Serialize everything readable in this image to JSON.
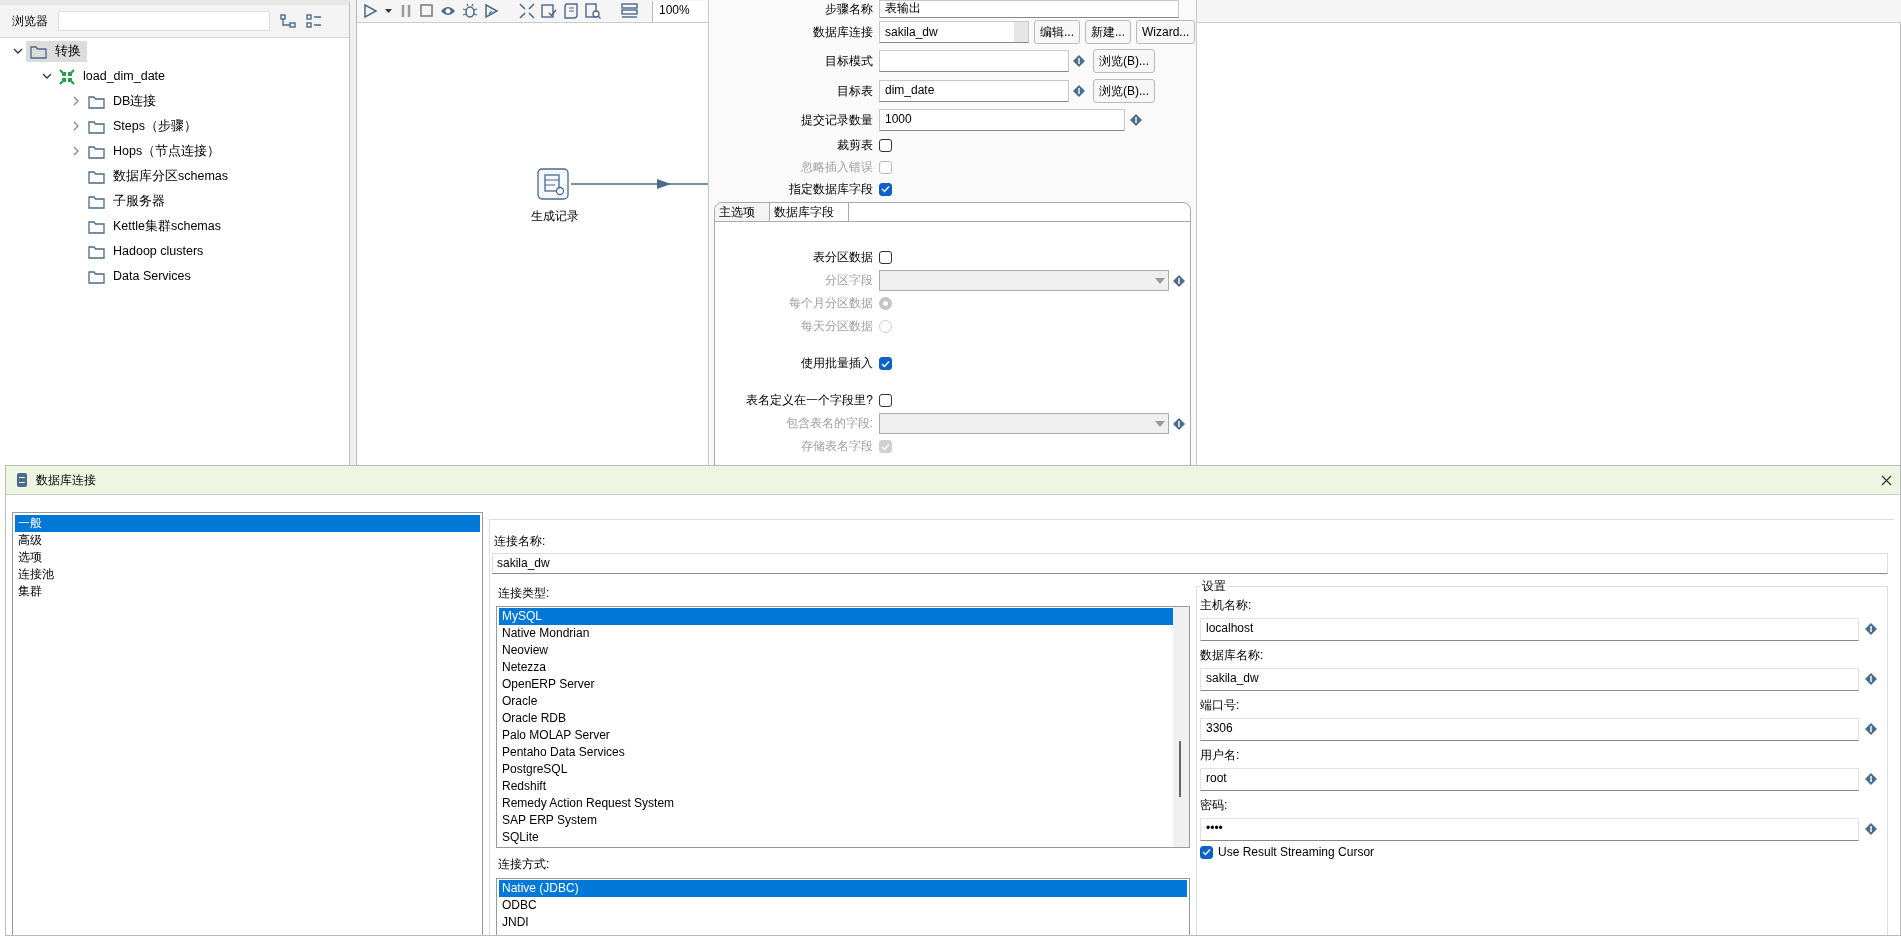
{
  "browser": {
    "label": "浏览器"
  },
  "tree": [
    {
      "label": "转换",
      "kind": "folder",
      "expanded": true,
      "selected": true,
      "children": [
        {
          "label": "load_dim_date",
          "kind": "transformation",
          "expanded": true,
          "selected": false,
          "children": [
            {
              "label": "DB连接",
              "kind": "folder",
              "expanded": false,
              "selected": false
            },
            {
              "label": "Steps（步骤）",
              "kind": "folder",
              "expanded": false,
              "selected": false
            },
            {
              "label": "Hops（节点连接）",
              "kind": "folder",
              "expanded": false,
              "selected": false
            },
            {
              "label": "数据库分区schemas",
              "kind": "folder",
              "selected": false
            },
            {
              "label": "子服务器",
              "kind": "folder",
              "selected": false
            },
            {
              "label": "Kettle集群schemas",
              "kind": "folder",
              "selected": false
            },
            {
              "label": "Hadoop clusters",
              "kind": "folder",
              "selected": false
            },
            {
              "label": "Data Services",
              "kind": "folder",
              "selected": false
            }
          ]
        }
      ]
    }
  ],
  "toolbar": {
    "zoom": "100%"
  },
  "canvas": {
    "steps": [
      {
        "label": "生成记录"
      }
    ]
  },
  "step_dialog": {
    "rows": [
      {
        "kind": "text",
        "label": "步骤名称",
        "value": "表输出"
      },
      {
        "kind": "connection",
        "label": "数据库连接",
        "value": "sakila_dw",
        "buttons": [
          "编辑...",
          "新建...",
          "Wizard..."
        ]
      },
      {
        "kind": "browse",
        "label": "目标模式",
        "button": "浏览(B)..."
      },
      {
        "kind": "browse",
        "label": "目标表",
        "value": "dim_date",
        "button": "浏览(B)..."
      },
      {
        "kind": "variable",
        "label": "提交记录数量",
        "value": "1000"
      },
      {
        "kind": "checkbox",
        "label": "裁剪表",
        "checked": false,
        "disabled": false
      },
      {
        "kind": "checkbox",
        "label": "忽略插入错误",
        "checked": false,
        "disabled": true
      },
      {
        "kind": "checkbox",
        "label": "指定数据库字段",
        "checked": true,
        "disabled": false
      }
    ],
    "tabs": [
      {
        "label": "主选项",
        "selected": true
      },
      {
        "label": "数据库字段",
        "selected": false
      }
    ],
    "tab_groups": [
      [
        {
          "kind": "checkbox",
          "label": "表分区数据",
          "checked": false,
          "disabled": false
        },
        {
          "kind": "combo",
          "label": "分区字段",
          "disabled": true
        },
        {
          "kind": "radio",
          "label": "每个月分区数据",
          "checked": true,
          "disabled": true
        },
        {
          "kind": "radio",
          "label": "每天分区数据",
          "checked": false,
          "disabled": true
        }
      ],
      [
        {
          "kind": "checkbox",
          "label": "使用批量插入",
          "checked": true,
          "disabled": false
        }
      ],
      [
        {
          "kind": "checkbox",
          "label": "表名定义在一个字段里?",
          "checked": false,
          "disabled": false
        },
        {
          "kind": "combo",
          "label": "包含表名的字段:",
          "disabled": true
        },
        {
          "kind": "checkbox",
          "label": "存储表名字段",
          "checked": true,
          "disabled": true
        }
      ]
    ]
  },
  "db_dialog": {
    "title": "数据库连接",
    "sections": [
      {
        "label": "一般",
        "selected": true
      },
      {
        "label": "高级",
        "selected": false
      },
      {
        "label": "选项",
        "selected": false
      },
      {
        "label": "连接池",
        "selected": false
      },
      {
        "label": "集群",
        "selected": false
      }
    ],
    "name_label": "连接名称:",
    "name_value": "sakila_dw",
    "type_label": "连接类型:",
    "types": [
      {
        "label": "MySQL",
        "selected": true
      },
      {
        "label": "Native Mondrian",
        "selected": false
      },
      {
        "label": "Neoview",
        "selected": false
      },
      {
        "label": "Netezza",
        "selected": false
      },
      {
        "label": "OpenERP Server",
        "selected": false
      },
      {
        "label": "Oracle",
        "selected": false
      },
      {
        "label": "Oracle RDB",
        "selected": false
      },
      {
        "label": "Palo MOLAP Server",
        "selected": false
      },
      {
        "label": "Pentaho Data Services",
        "selected": false
      },
      {
        "label": "PostgreSQL",
        "selected": false
      },
      {
        "label": "Redshift",
        "selected": false
      },
      {
        "label": "Remedy Action Request System",
        "selected": false
      },
      {
        "label": "SAP ERP System",
        "selected": false
      },
      {
        "label": "SQLite",
        "selected": false
      }
    ],
    "access_label": "连接方式:",
    "access": [
      {
        "label": "Native (JDBC)",
        "selected": true
      },
      {
        "label": "ODBC",
        "selected": false
      },
      {
        "label": "JNDI",
        "selected": false
      }
    ],
    "settings": {
      "legend": "设置",
      "fields": [
        {
          "label": "主机名称:",
          "value": "localhost"
        },
        {
          "label": "数据库名称:",
          "value": "sakila_dw"
        },
        {
          "label": "端口号:",
          "value": "3306"
        },
        {
          "label": "用户名:",
          "value": "root"
        },
        {
          "label": "密码:",
          "value": "••••"
        }
      ],
      "streaming": {
        "label": "Use Result Streaming Cursor",
        "checked": true
      }
    }
  }
}
